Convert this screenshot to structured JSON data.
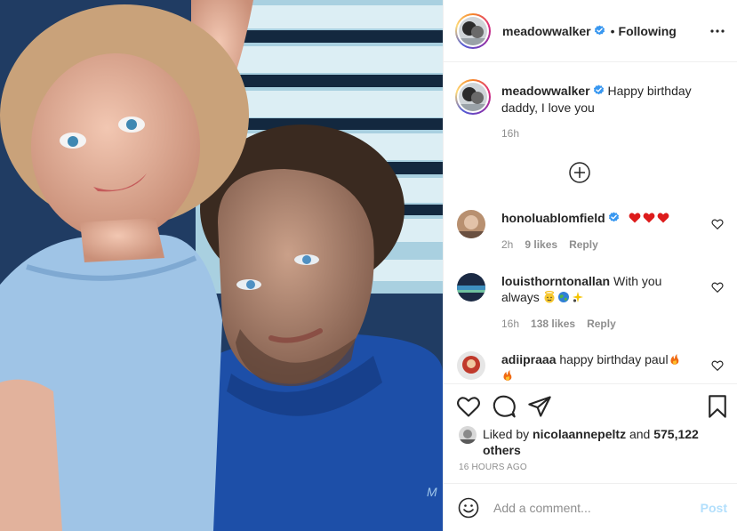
{
  "post": {
    "author": "meadowwalker",
    "follow_status": "Following",
    "dot": "•",
    "caption": "Happy birthday daddy, I love you",
    "caption_time": "16h",
    "likes_prefix": "Liked by",
    "liked_by_user": "nicolaannepeltz",
    "likes_and": "and",
    "likes_others": "575,122 others",
    "time_ago": "16 HOURS AGO"
  },
  "comments": [
    {
      "user": "honoluablomfield",
      "text": "",
      "emojis": [
        "heart",
        "heart",
        "heart"
      ],
      "time": "2h",
      "likes": "9 likes",
      "reply": "Reply"
    },
    {
      "user": "louisthorntonallan",
      "text": "With you always",
      "emojis": [
        "angel",
        "globe",
        "sparkle"
      ],
      "time": "16h",
      "likes": "138 likes",
      "reply": "Reply"
    },
    {
      "user": "adiipraaa",
      "text": "happy birthday paul",
      "emojis": [
        "fire",
        "fire"
      ]
    }
  ],
  "add_comment": {
    "placeholder": "Add a comment...",
    "post_label": "Post"
  },
  "icons": {
    "more": "more-options-icon",
    "verified": "verified-badge-icon",
    "load_more": "load-more-comments-icon",
    "like": "heart-icon",
    "comment": "comment-bubble-icon",
    "share": "paper-plane-icon",
    "save": "bookmark-icon",
    "emoji": "emoji-smiley-icon"
  },
  "colors": {
    "verified": "#3897f0",
    "muted": "#8e8e8e",
    "text": "#262626",
    "post_disabled": "#b2dffc",
    "heart": "#ed4956",
    "border": "#efefef"
  }
}
